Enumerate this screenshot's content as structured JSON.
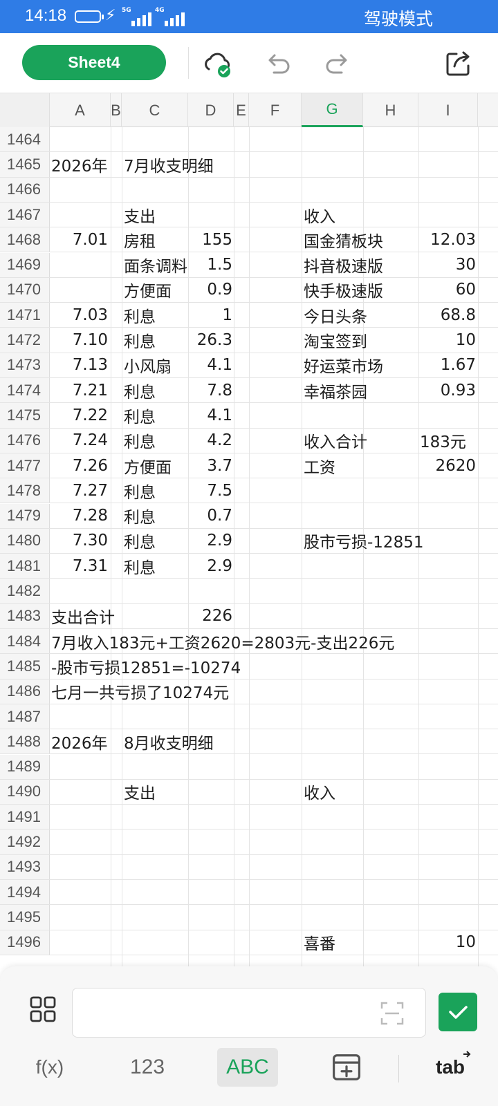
{
  "status_bar": {
    "time": "14:18",
    "network_1": "5G",
    "network_2": "4G",
    "mode": "驾驶模式"
  },
  "toolbar": {
    "sheet_label": "Sheet4",
    "icons": [
      "cloud-saved-icon",
      "undo-icon",
      "redo-icon",
      "share-icon"
    ]
  },
  "columns": [
    "A",
    "B",
    "C",
    "D",
    "E",
    "F",
    "G",
    "H",
    "I"
  ],
  "active_column": "G",
  "rows": [
    {
      "num": "1464",
      "A": "",
      "C": "",
      "D": "",
      "G": "",
      "I": ""
    },
    {
      "num": "1465",
      "A": "2026年",
      "C": "7月收支明细",
      "D": "",
      "G": "",
      "I": ""
    },
    {
      "num": "1466",
      "A": "",
      "C": "",
      "D": "",
      "G": "",
      "I": ""
    },
    {
      "num": "1467",
      "A": "",
      "C": "支出",
      "D": "",
      "G": "收入",
      "I": ""
    },
    {
      "num": "1468",
      "A": "7.01",
      "C": "房租",
      "D": "155",
      "G": "国金猜板块",
      "I": "12.03"
    },
    {
      "num": "1469",
      "A": "",
      "C": "面条调料",
      "D": "1.5",
      "G": "抖音极速版",
      "I": "30"
    },
    {
      "num": "1470",
      "A": "",
      "C": "方便面",
      "D": "0.9",
      "G": "快手极速版",
      "I": "60"
    },
    {
      "num": "1471",
      "A": "7.03",
      "C": "利息",
      "D": "1",
      "G": "今日头条",
      "I": "68.8"
    },
    {
      "num": "1472",
      "A": "7.10",
      "C": "利息",
      "D": "26.3",
      "G": "淘宝签到",
      "I": "10"
    },
    {
      "num": "1473",
      "A": "7.13",
      "C": "小风扇",
      "D": "4.1",
      "G": "好运菜市场",
      "I": "1.67"
    },
    {
      "num": "1474",
      "A": "7.21",
      "C": "利息",
      "D": "7.8",
      "G": "幸福茶园",
      "I": "0.93"
    },
    {
      "num": "1475",
      "A": "7.22",
      "C": "利息",
      "D": "4.1",
      "G": "",
      "I": ""
    },
    {
      "num": "1476",
      "A": "7.24",
      "C": "利息",
      "D": "4.2",
      "G": "收入合计",
      "I": "183元"
    },
    {
      "num": "1477",
      "A": "7.26",
      "C": "方便面",
      "D": "3.7",
      "G": "工资",
      "I": "2620"
    },
    {
      "num": "1478",
      "A": "7.27",
      "C": "利息",
      "D": "7.5",
      "G": "",
      "I": ""
    },
    {
      "num": "1479",
      "A": "7.28",
      "C": "利息",
      "D": "0.7",
      "G": "",
      "I": ""
    },
    {
      "num": "1480",
      "A": "7.30",
      "C": "利息",
      "D": "2.9",
      "G": "股市亏损-12851",
      "I": ""
    },
    {
      "num": "1481",
      "A": "7.31",
      "C": "利息",
      "D": "2.9",
      "G": "",
      "I": ""
    },
    {
      "num": "1482",
      "A": "",
      "C": "",
      "D": "",
      "G": "",
      "I": ""
    },
    {
      "num": "1483",
      "A": "支出合计",
      "C": "",
      "D": "226",
      "G": "",
      "I": ""
    },
    {
      "num": "1484",
      "A": "7月收入183元+工资2620=2803元-支出226元",
      "C": "",
      "D": "",
      "G": "",
      "I": ""
    },
    {
      "num": "1485",
      "A": "-股市亏损12851=-10274",
      "C": "",
      "D": "",
      "G": "",
      "I": ""
    },
    {
      "num": "1486",
      "A": "七月一共亏损了10274元",
      "C": "",
      "D": "",
      "G": "",
      "I": ""
    },
    {
      "num": "1487",
      "A": "",
      "C": "",
      "D": "",
      "G": "",
      "I": ""
    },
    {
      "num": "1488",
      "A": "2026年",
      "C": "8月收支明细",
      "D": "",
      "G": "",
      "I": ""
    },
    {
      "num": "1489",
      "A": "",
      "C": "",
      "D": "",
      "G": "",
      "I": ""
    },
    {
      "num": "1490",
      "A": "",
      "C": "支出",
      "D": "",
      "G": "收入",
      "I": ""
    },
    {
      "num": "1491",
      "A": "",
      "C": "",
      "D": "",
      "G": "",
      "I": ""
    },
    {
      "num": "1492",
      "A": "",
      "C": "",
      "D": "",
      "G": "",
      "I": ""
    },
    {
      "num": "1493",
      "A": "",
      "C": "",
      "D": "",
      "G": "",
      "I": ""
    },
    {
      "num": "1494",
      "A": "",
      "C": "",
      "D": "",
      "G": "",
      "I": ""
    },
    {
      "num": "1495",
      "A": "",
      "C": "",
      "D": "",
      "G": "",
      "I": ""
    },
    {
      "num": "1496",
      "A": "",
      "C": "",
      "D": "",
      "G": "喜番",
      "I": "10"
    }
  ],
  "formula_bar": {
    "value": "",
    "icons": [
      "grid-menu-icon",
      "scan-icon",
      "confirm-check-icon"
    ]
  },
  "keyboard_tabs": {
    "fx": "f(x)",
    "num": "123",
    "abc": "ABC",
    "table_icon": "table-insert-icon",
    "tab": "tab"
  },
  "colors": {
    "status_bar": "#2f7ce6",
    "accent_green": "#1aa35a"
  }
}
